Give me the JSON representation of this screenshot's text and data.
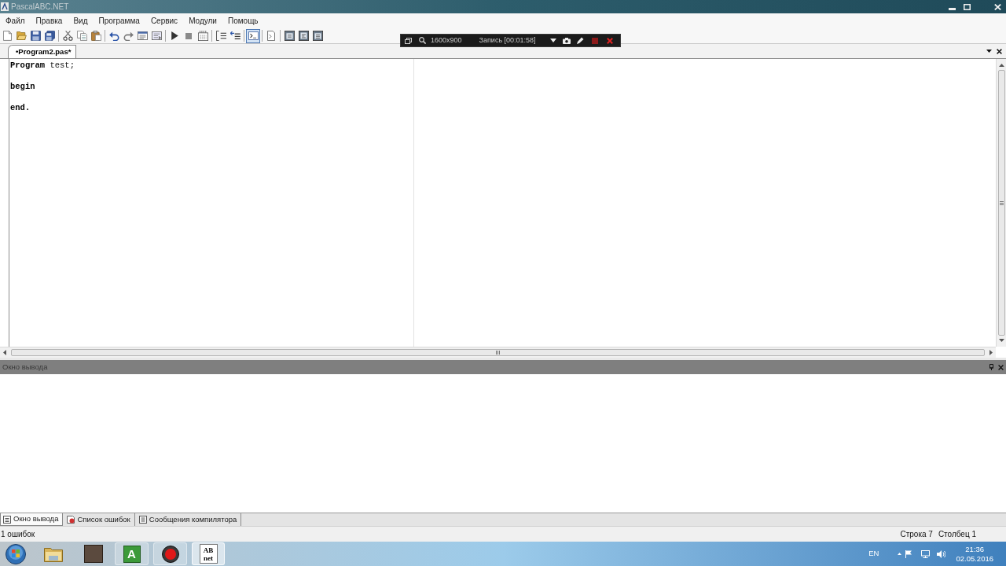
{
  "window": {
    "title": "PascalABC.NET"
  },
  "menu": [
    "Файл",
    "Правка",
    "Вид",
    "Программа",
    "Сервис",
    "Модули",
    "Помощь"
  ],
  "toolbar": {
    "groups": [
      [
        {
          "pressed": false
        },
        {
          "pressed": false
        },
        {
          "pressed": false
        },
        {
          "pressed": false
        }
      ],
      [
        {
          "pressed": false
        },
        {
          "pressed": false
        },
        {
          "pressed": false
        }
      ],
      [
        {
          "pressed": false
        },
        {
          "pressed": false
        },
        {
          "pressed": false
        },
        {
          "pressed": false
        }
      ],
      [
        {
          "pressed": false
        },
        {
          "pressed": false
        },
        {
          "pressed": false
        }
      ],
      [
        {
          "pressed": false
        },
        {
          "pressed": false
        }
      ],
      [
        {
          "pressed": true
        }
      ],
      [
        {
          "pressed": false
        }
      ],
      [
        {
          "pressed": false
        },
        {
          "pressed": false
        },
        {
          "pressed": false
        }
      ]
    ]
  },
  "recording_bar": {
    "size": "1600x900",
    "status": "Запись [00:01:58]"
  },
  "editor_tabs": [
    {
      "label": "•Program2.pas*",
      "selected": true
    }
  ],
  "editor": {
    "lines": [
      {
        "kind": "code",
        "tokens": [
          {
            "text": "Program",
            "keyword": true
          },
          {
            "text": "test;",
            "keyword": false
          }
        ]
      },
      {
        "kind": "blank"
      },
      {
        "kind": "code",
        "tokens": [
          {
            "text": "begin",
            "keyword": true
          }
        ]
      },
      {
        "kind": "blank"
      },
      {
        "kind": "code",
        "tokens": [
          {
            "text": "end.",
            "keyword": true
          }
        ]
      }
    ]
  },
  "output_panel": {
    "title": "Окно вывода"
  },
  "bottom_tabs": [
    {
      "label": "Окно вывода",
      "selected": true
    },
    {
      "label": "Список ошибок",
      "selected": false
    },
    {
      "label": "Сообщения компилятора",
      "selected": false
    }
  ],
  "status_bar": {
    "message": "1 ошибок",
    "line": "Строка 7",
    "column": "Столбец 1"
  },
  "taskbar": {
    "apps": [
      {
        "running": false,
        "selected": false
      },
      {
        "running": false,
        "selected": false
      },
      {
        "running": true,
        "selected": false,
        "logo_lines": [
          "A"
        ]
      },
      {
        "running": true,
        "selected": false
      },
      {
        "running": true,
        "selected": true,
        "logo_lines": [
          "AB",
          "net"
        ]
      }
    ],
    "language": "EN",
    "time": "21:36",
    "date": "02.05.2016"
  }
}
